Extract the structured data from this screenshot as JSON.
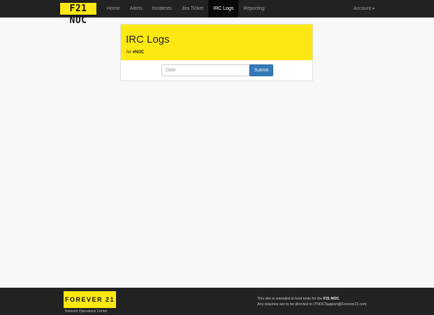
{
  "navbar": {
    "brand": "F21 NOC",
    "items": [
      {
        "label": "Home"
      },
      {
        "label": "Alerts"
      },
      {
        "label": "Incidents"
      },
      {
        "label": "Jira Ticket"
      },
      {
        "label": "IRC Logs"
      },
      {
        "label": "Reporting"
      }
    ],
    "active_item": "IRC Logs",
    "account": "Account",
    "account_caret_icon": "caret-down-icon"
  },
  "panel": {
    "title": "IRC Logs",
    "subtitle_prefix": "for",
    "channel": "#NOC",
    "date_placeholder": "Date",
    "date_value": "",
    "submit_label": "Submit"
  },
  "footer": {
    "logo_text": "FOREVER 21",
    "tagline": "Network Operations Center",
    "line1_prefix": "This site is intended to host tools for the",
    "line1_bold": "F21 NOC",
    "line1_suffix": ".",
    "line2": "Any inquiries are to be directed to ITNOCSupport@Forever21.com"
  },
  "colors": {
    "brand_yellow": "#fde811",
    "navbar_bg": "#222222",
    "submit_blue": "#337ab7"
  }
}
